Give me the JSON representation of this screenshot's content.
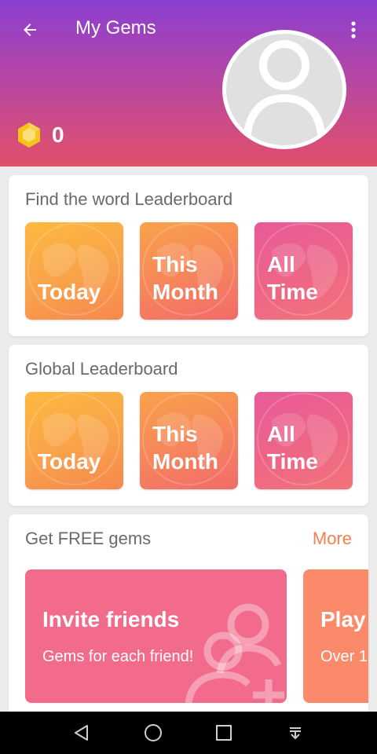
{
  "app_bar": {
    "title": "My Gems",
    "gem_count": "0",
    "back_icon": "arrow-back-icon",
    "menu_icon": "more-vert-icon"
  },
  "find_word": {
    "title": "Find the word Leaderboard",
    "tiles": [
      {
        "label": "Today"
      },
      {
        "label": "This\nMonth"
      },
      {
        "label": "All\nTime"
      }
    ]
  },
  "global": {
    "title": "Global Leaderboard",
    "tiles": [
      {
        "label": "Today"
      },
      {
        "label": "This\nMonth"
      },
      {
        "label": "All\nTime"
      }
    ]
  },
  "free_gems": {
    "title": "Get FREE gems",
    "more_label": "More",
    "promos": [
      {
        "title": "Invite friends",
        "subtitle": "Gems for each friend!"
      },
      {
        "title": "Play",
        "subtitle": "Over 1"
      }
    ]
  },
  "colors": {
    "header_top": "#8a3fd0",
    "header_bottom": "#e2506a",
    "accent": "#f3804e",
    "gem": "#f5c518"
  }
}
